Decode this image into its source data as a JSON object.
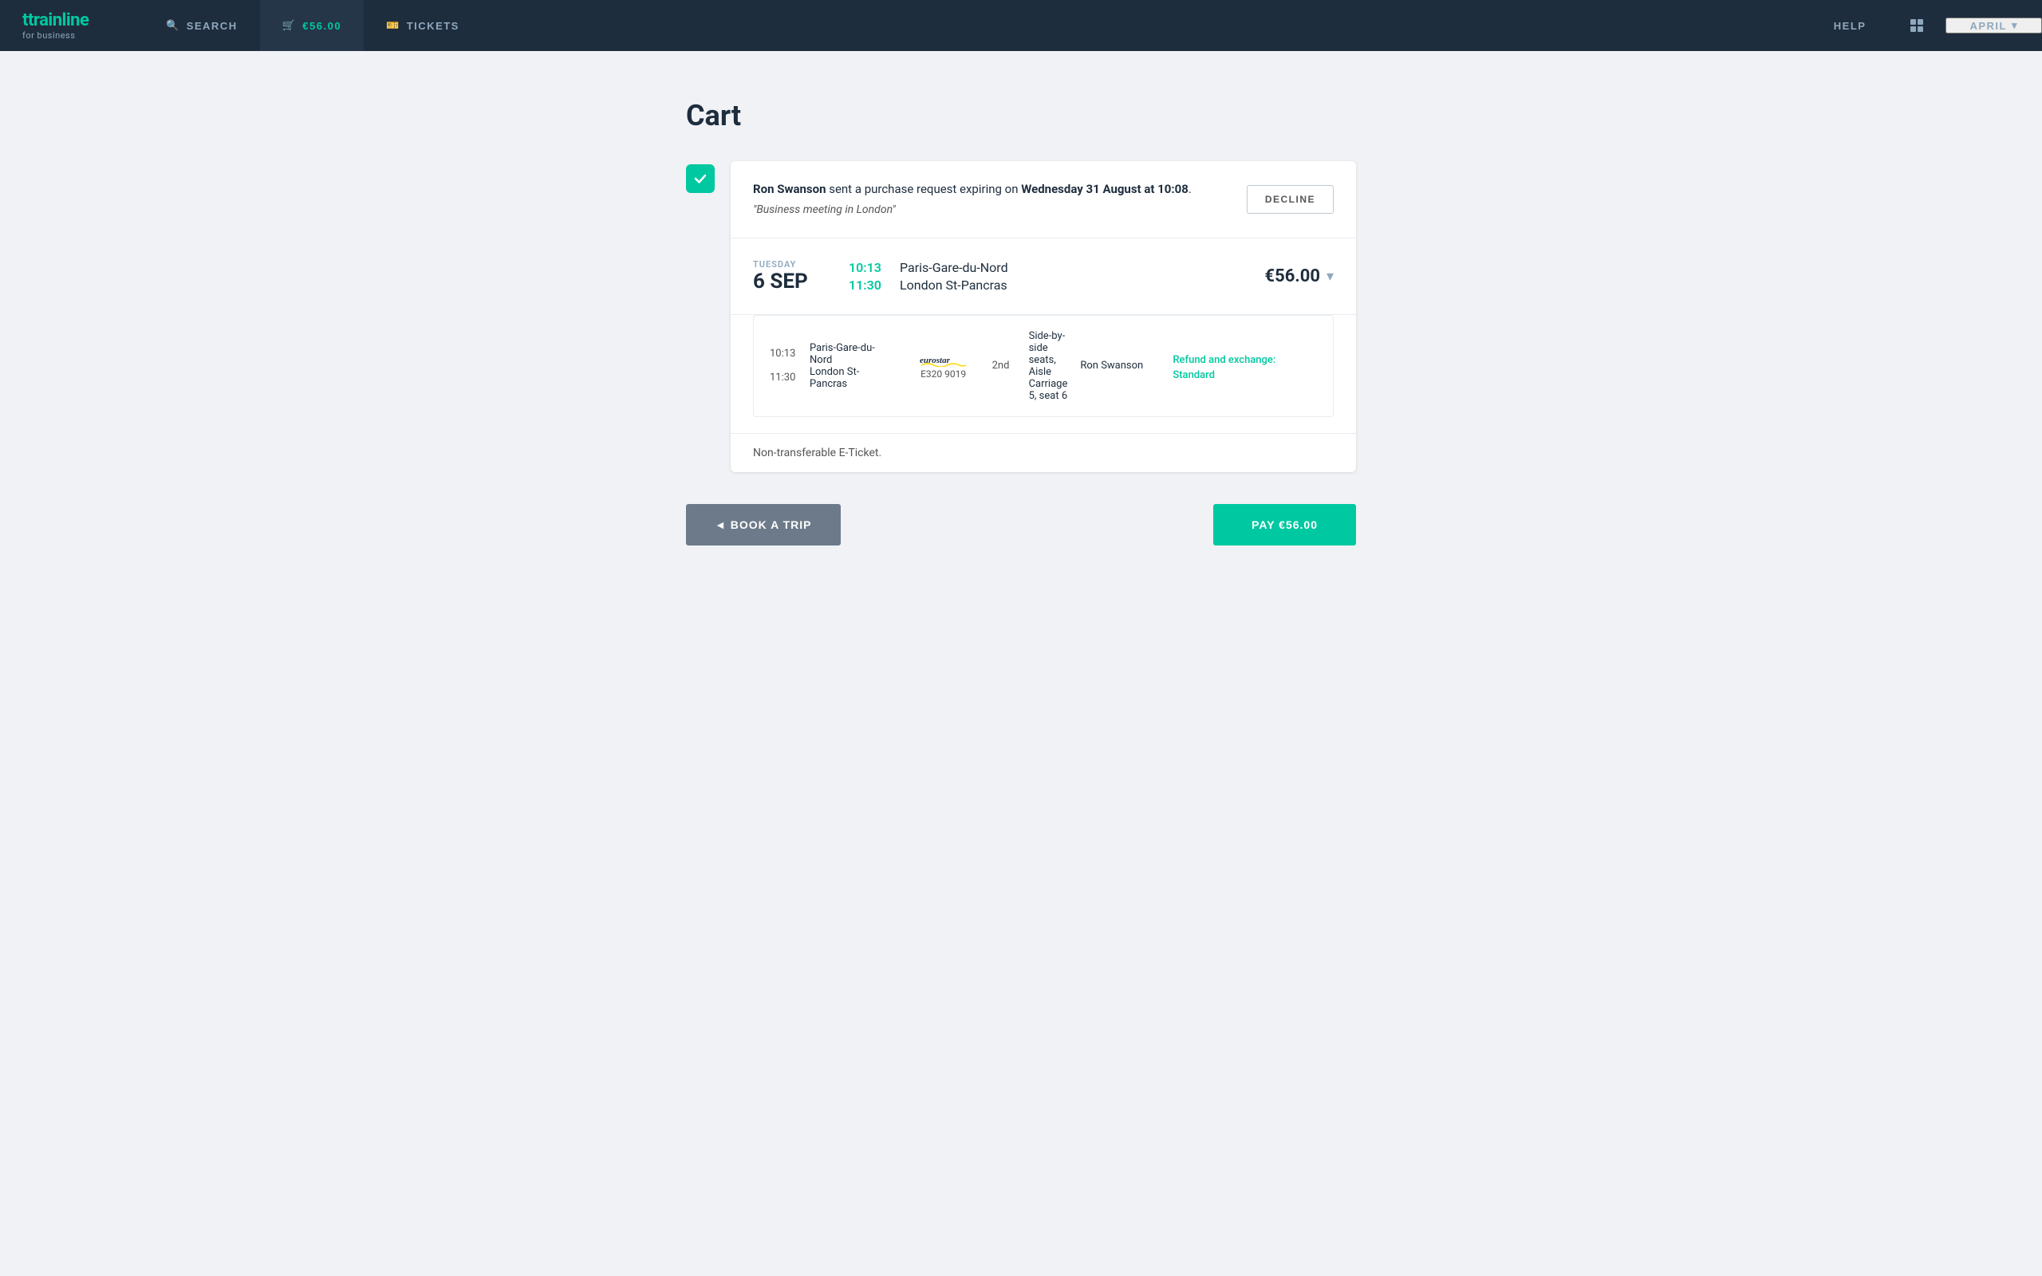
{
  "nav": {
    "logo_main": "trainline",
    "logo_sub": "for business",
    "search_label": "SEARCH",
    "cart_label": "€56.00",
    "tickets_label": "TICKETS",
    "help_label": "HELP",
    "user_label": "APRIL"
  },
  "page": {
    "title": "Cart"
  },
  "purchase_request": {
    "requester": "Ron Swanson",
    "message_pre": " sent a purchase request expiring on ",
    "expiry": "Wednesday 31 August at 10:08",
    "message_post": ".",
    "quote": "\"Business meeting in London\"",
    "decline_label": "DECLINE"
  },
  "trip": {
    "day": "TUESDAY",
    "date": "6 SEP",
    "depart_time": "10:13",
    "depart_station": "Paris-Gare-du-Nord",
    "arrive_time": "11:30",
    "arrive_station": "London St-Pancras",
    "price": "€56.00"
  },
  "ticket": {
    "depart_time": "10:13",
    "depart_station": "Paris-Gare-du-Nord",
    "arrive_time": "11:30",
    "arrive_station": "London St-Pancras",
    "train_name": "Eurostar",
    "train_number": "E320 9019",
    "class": "2nd",
    "seats": "Side-by-side seats, Aisle Carriage 5, seat 6",
    "passenger": "Ron Swanson",
    "refund_policy": "Refund and exchange: Standard"
  },
  "non_transferable": {
    "text": "Non-transferable E-Ticket."
  },
  "buttons": {
    "back_label": "◄ BOOK A TRIP",
    "pay_label": "PAY €56.00"
  }
}
